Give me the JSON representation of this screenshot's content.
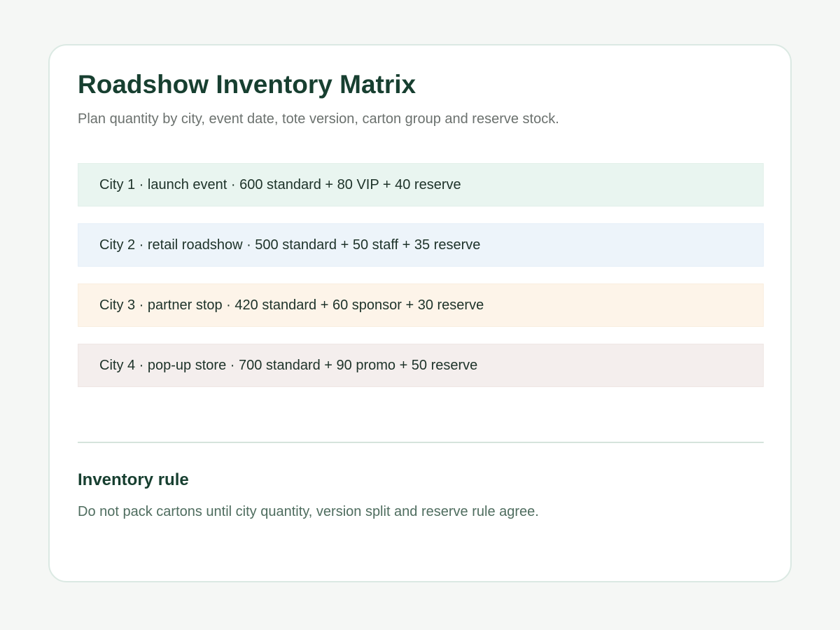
{
  "header": {
    "title": "Roadshow Inventory Matrix",
    "subtitle": "Plan quantity by city, event date, tote version, carton group and reserve stock."
  },
  "rows": [
    {
      "text": "City 1 · launch event · 600 standard + 80 VIP + 40 reserve",
      "background": "#e9f5f0"
    },
    {
      "text": "City 2 · retail roadshow · 500 standard + 50 staff + 35 reserve",
      "background": "#edf4fa"
    },
    {
      "text": "City 3 · partner stop · 420 standard + 60 sponsor + 30 reserve",
      "background": "#fdf4e9"
    },
    {
      "text": "City 4 · pop-up store · 700 standard + 90 promo + 50 reserve",
      "background": "#f4eeed"
    }
  ],
  "rule": {
    "heading": "Inventory rule",
    "text": "Do not pack cartons until city quantity, version split and reserve rule agree."
  },
  "colors": {
    "page_background": "#f5f7f5",
    "card_border": "#dbe9e3",
    "title": "#173f30",
    "subtitle": "#6b716e",
    "rule_text": "#4f6d5f"
  }
}
